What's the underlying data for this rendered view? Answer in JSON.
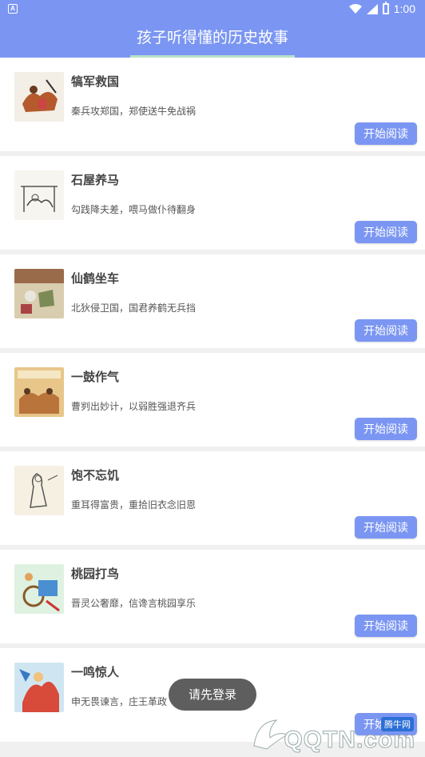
{
  "status_bar": {
    "time": "1:00",
    "left_icon": "A",
    "icons": [
      "wifi-icon",
      "signal-icon",
      "battery-icon"
    ]
  },
  "app_bar": {
    "title": "孩子听得懂的历史故事"
  },
  "stories": [
    {
      "title": "犒军救国",
      "desc": "秦兵攻郑国，郑使送牛免战祸",
      "button": "开始阅读"
    },
    {
      "title": "石屋养马",
      "desc": "勾践降夫差，喂马做仆待翻身",
      "button": "开始阅读"
    },
    {
      "title": "仙鹤坐车",
      "desc": "北狄侵卫国，国君养鹤无兵挡",
      "button": "开始阅读"
    },
    {
      "title": "一鼓作气",
      "desc": "曹刿出妙计，以弱胜强退齐兵",
      "button": "开始阅读"
    },
    {
      "title": "饱不忘饥",
      "desc": "重耳得富贵，重拾旧衣念旧恩",
      "button": "开始阅读"
    },
    {
      "title": "桃园打鸟",
      "desc": "晋灵公奢靡，信谗言桃园享乐",
      "button": "开始阅读"
    },
    {
      "title": "一鸣惊人",
      "desc": "申无畏谏言，庄王革政",
      "button": "开始阅读"
    }
  ],
  "toast": "请先登录",
  "watermark": {
    "tag": "腾牛网",
    "text": "QQTN.com"
  },
  "colors": {
    "primary": "#7b96f2",
    "underline": "#b9e0c8",
    "background": "#f0f0f0"
  }
}
